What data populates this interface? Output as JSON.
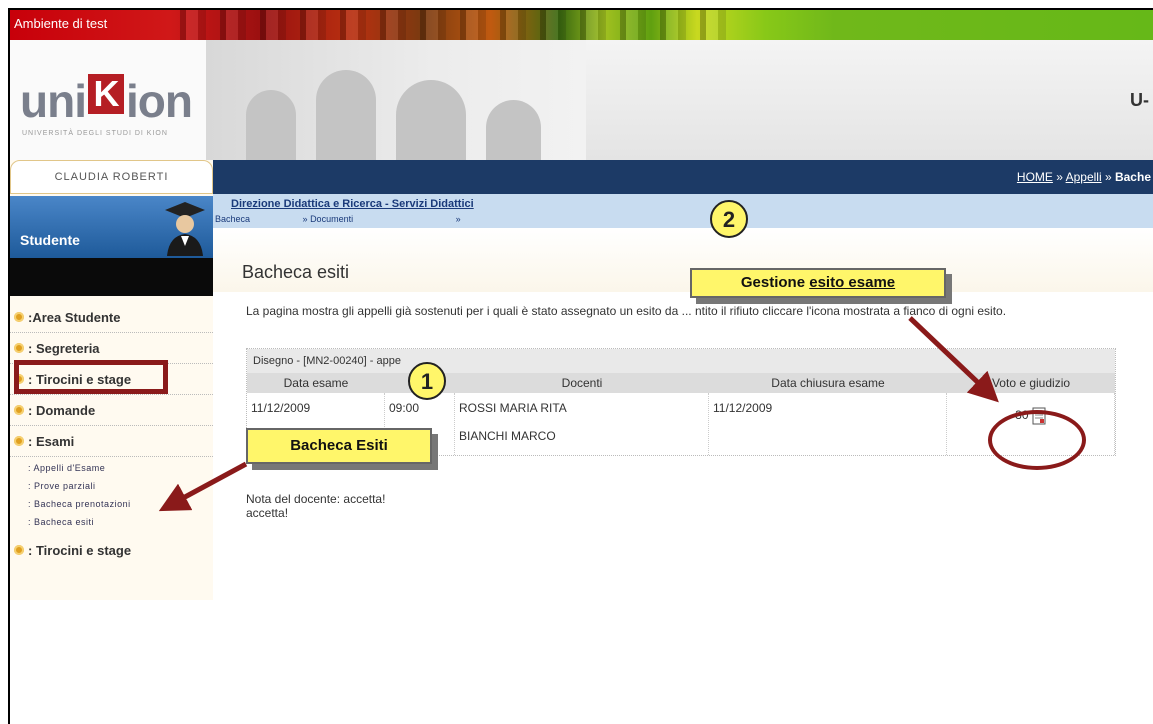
{
  "testbar": {
    "label": "Ambiente di test"
  },
  "header": {
    "logo_uni": "uni",
    "logo_k": "K",
    "logo_ion": "ion",
    "logo_sub": "UNIVERSITÀ DEGLI STUDI DI KION",
    "right_cut": "U-"
  },
  "nav": {
    "crumbs": [
      "HOME",
      "Appelli",
      "Bache"
    ]
  },
  "sidebar": {
    "user": "CLAUDIA ROBERTI",
    "role": "Studente",
    "menu": [
      ":Area Studente",
      ": Segreteria",
      ": Tirocini e stage",
      ": Domande",
      ": Esami"
    ],
    "sub": [
      "Appelli d'Esame",
      "Prove parziali",
      "Bacheca prenotazioni",
      "Bacheca esiti"
    ],
    "after": ": Tirocini e stage"
  },
  "content": {
    "direction": "Direzione Didattica e Ricerca - Servizi Didattici",
    "tabs": [
      "Bacheca",
      "Documenti"
    ],
    "title": "Bacheca esiti",
    "desc": "La pagina mostra gli appelli già sostenuti per i quali è stato assegnato un esito da ... ntito il rifiuto cliccare l'icona mostrata a fianco di ogni esito.",
    "table": {
      "caption": "Disegno - [MN2-00240] - appe",
      "headers": [
        "Data esame",
        "",
        "Docenti",
        "Data chiusura esame",
        "Voto e giudizio"
      ],
      "row": {
        "data": "11/12/2009",
        "ora": "09:00",
        "docenti1": "ROSSI MARIA RITA",
        "docenti2": "BIANCHI MARCO",
        "chiusura": "11/12/2009",
        "voto": "30"
      }
    },
    "note1": "Nota del docente: accetta!",
    "note2": "accetta!"
  },
  "callouts": {
    "one": "1",
    "two": "2",
    "bacheca": "Bacheca Esiti",
    "gestione_pre": "Gestione ",
    "gestione_u": "esito esame"
  },
  "colors": {
    "nav": "#1c3a66",
    "callout": "#fff66a",
    "arrow": "#8a1a1a"
  }
}
